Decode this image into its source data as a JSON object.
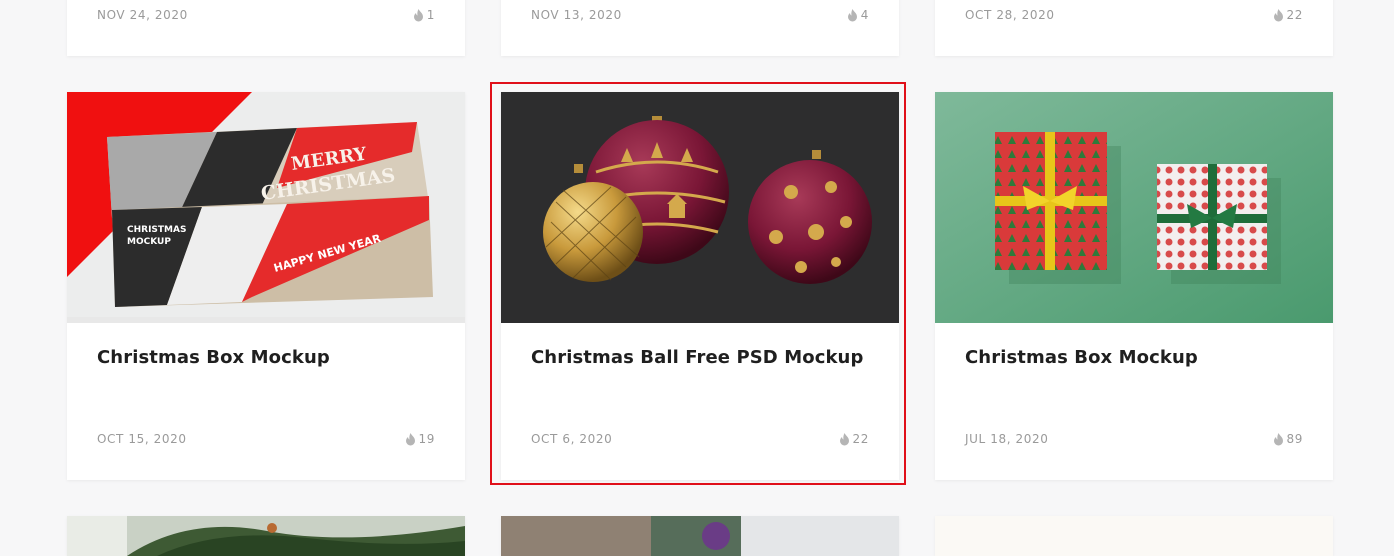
{
  "top_row": [
    {
      "date": "NOV 24, 2020",
      "likes": "1"
    },
    {
      "date": "NOV 13, 2020",
      "likes": "4"
    },
    {
      "date": "OCT 28, 2020",
      "likes": "22"
    }
  ],
  "middle_row": [
    {
      "title": "Christmas Box Mockup",
      "date": "OCT 15, 2020",
      "likes": "19",
      "image": "christmas-wooden-crates"
    },
    {
      "title": "Christmas Ball Free PSD Mockup",
      "date": "OCT 6, 2020",
      "likes": "22",
      "image": "christmas-ornament-balls"
    },
    {
      "title": "Christmas Box Mockup",
      "date": "JUL 18, 2020",
      "likes": "89",
      "image": "wrapped-gift-boxes"
    }
  ],
  "icons": {
    "likes": "flame-icon"
  },
  "colors": {
    "highlight_border": "#e0101a",
    "page_background": "#f7f7f8"
  }
}
